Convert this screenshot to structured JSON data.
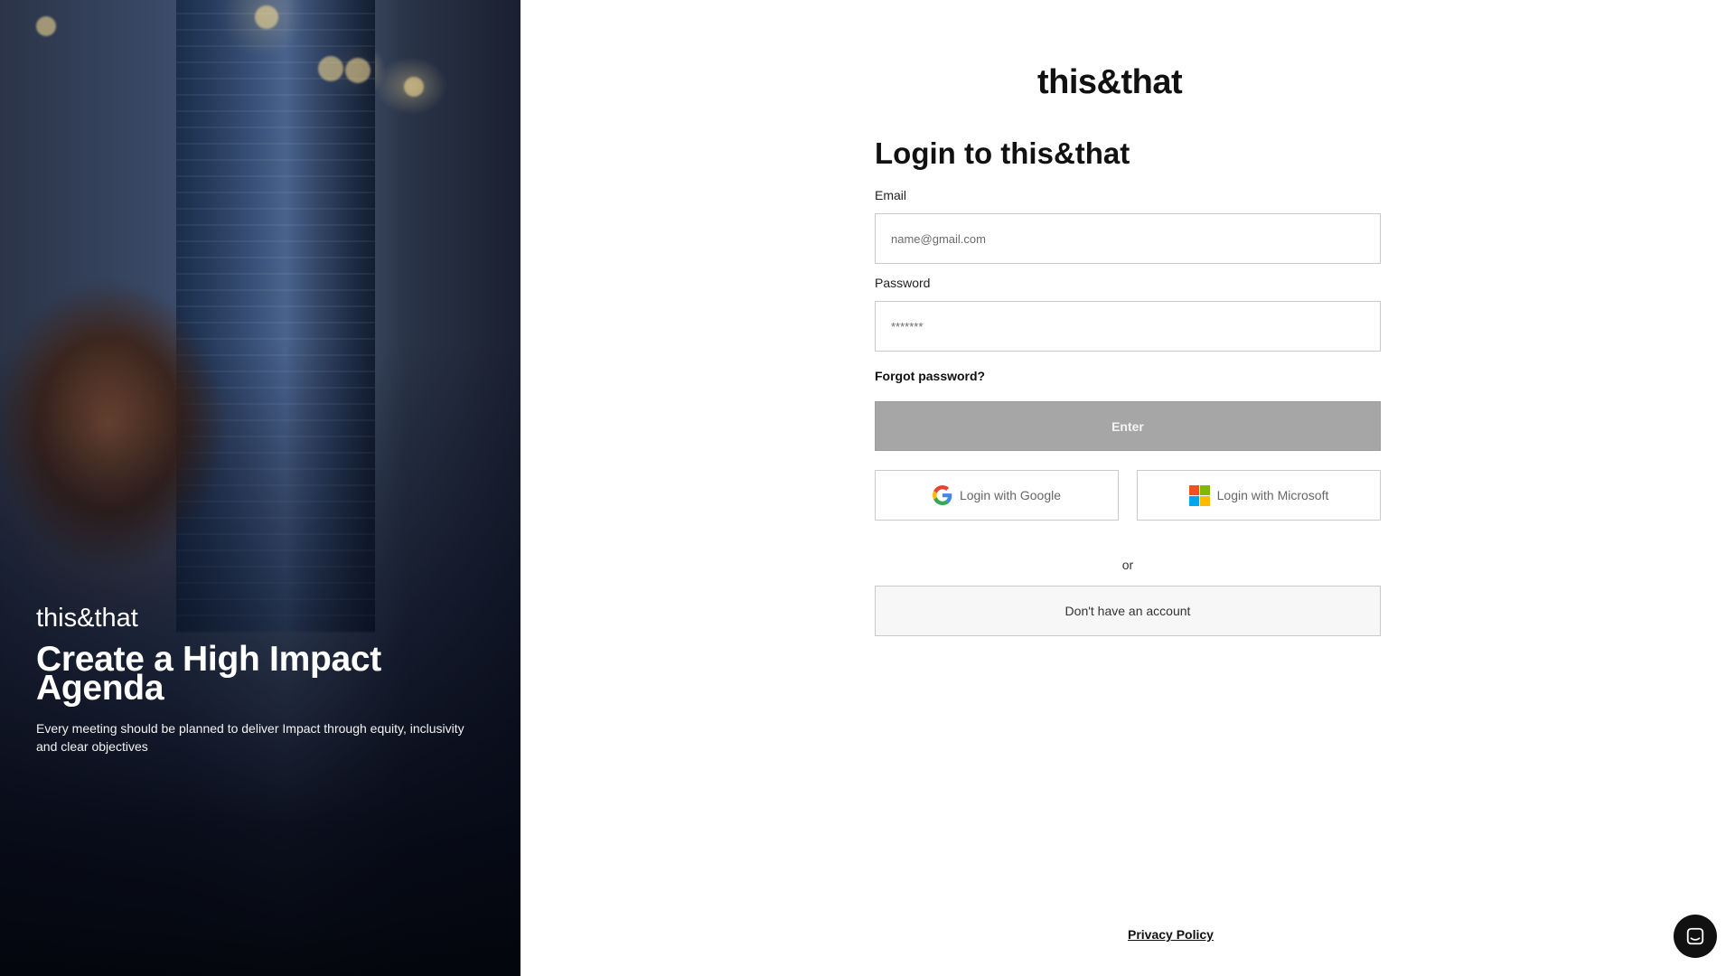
{
  "hero": {
    "brand": "this&that",
    "title": "Create a High Impact Agenda",
    "subtitle": "Every meeting should be planned to deliver Impact through equity, inclusivity and clear objectives"
  },
  "logo": "this&that",
  "login": {
    "title": "Login to this&that",
    "email_label": "Email",
    "email_placeholder": "name@gmail.com",
    "password_label": "Password",
    "password_placeholder": "*******",
    "forgot_label": "Forgot password?",
    "enter_label": "Enter",
    "google_label": "Login with Google",
    "microsoft_label": "Login with Microsoft",
    "or_label": "or",
    "signup_label": "Don't have an account"
  },
  "footer": {
    "privacy_label": "Privacy Policy"
  },
  "icons": {
    "google": "google-icon",
    "microsoft": "microsoft-icon",
    "chat": "chat-icon"
  },
  "colors": {
    "enter_button_bg": "#a6a6a6",
    "chat_button_bg": "#111111"
  }
}
